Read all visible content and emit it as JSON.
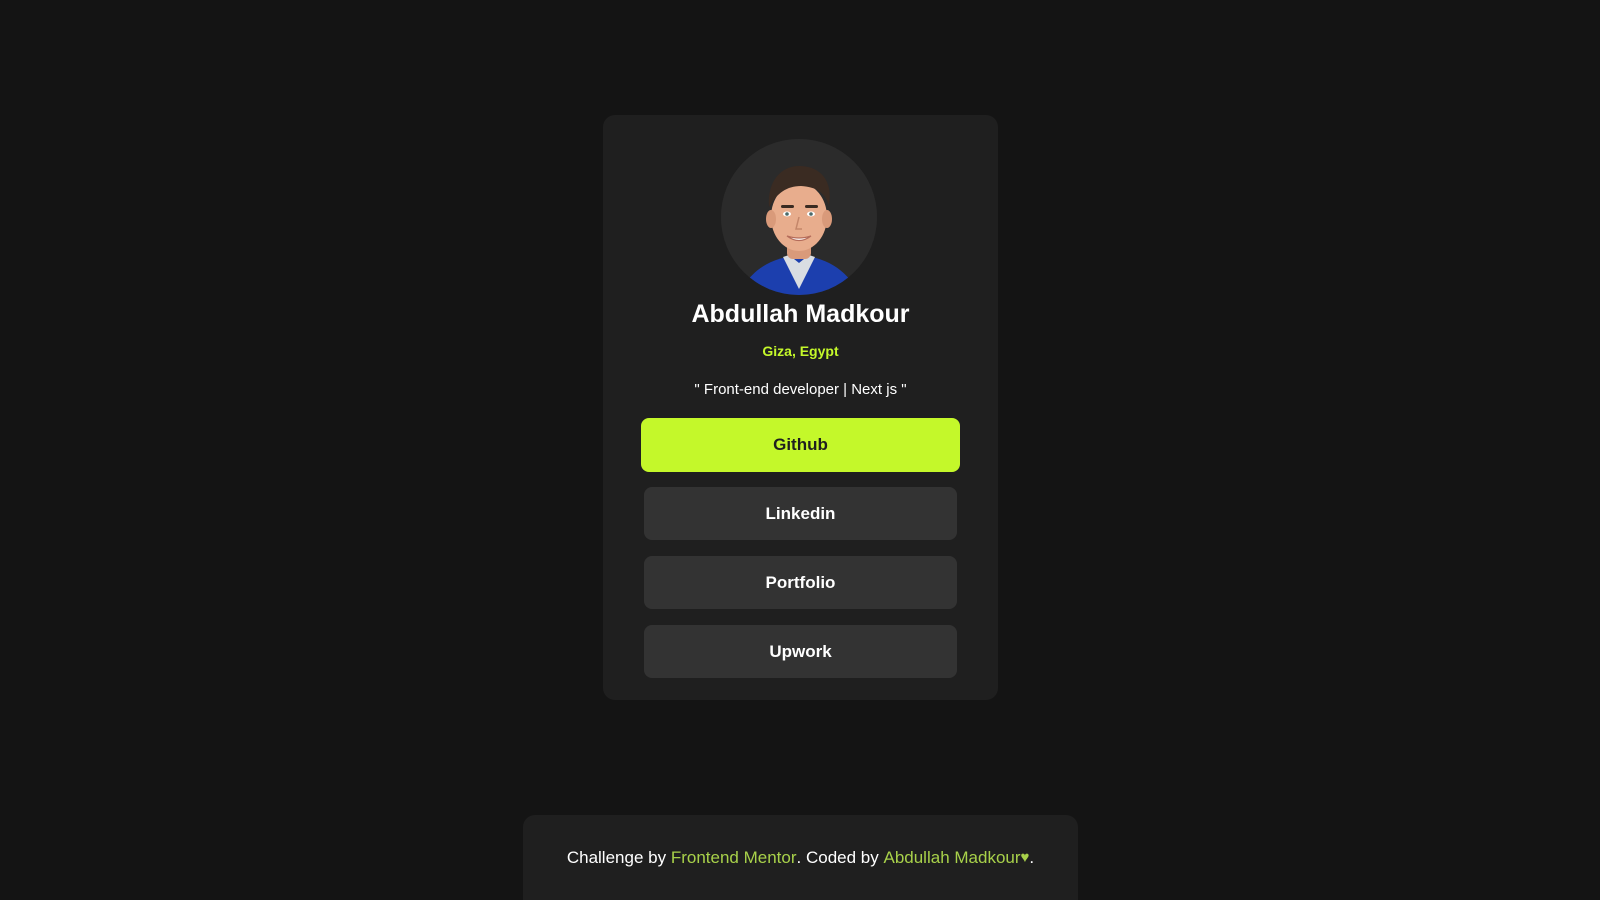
{
  "profile": {
    "name": "Abdullah Madkour",
    "location": "Giza, Egypt",
    "bio": "\" Front-end developer | Next js \""
  },
  "links": [
    {
      "label": "Github"
    },
    {
      "label": "Linkedin"
    },
    {
      "label": "Portfolio"
    },
    {
      "label": "Upwork"
    }
  ],
  "footer": {
    "prefix": "Challenge by ",
    "challenge_link": "Frontend Mentor",
    "middle": ". Coded by ",
    "author_link": "Abdullah Madkour",
    "heart": "♥",
    "suffix": "."
  },
  "colors": {
    "accent": "#c4f82a",
    "background": "#141414",
    "card": "#1f1f1f",
    "button": "#333333"
  }
}
